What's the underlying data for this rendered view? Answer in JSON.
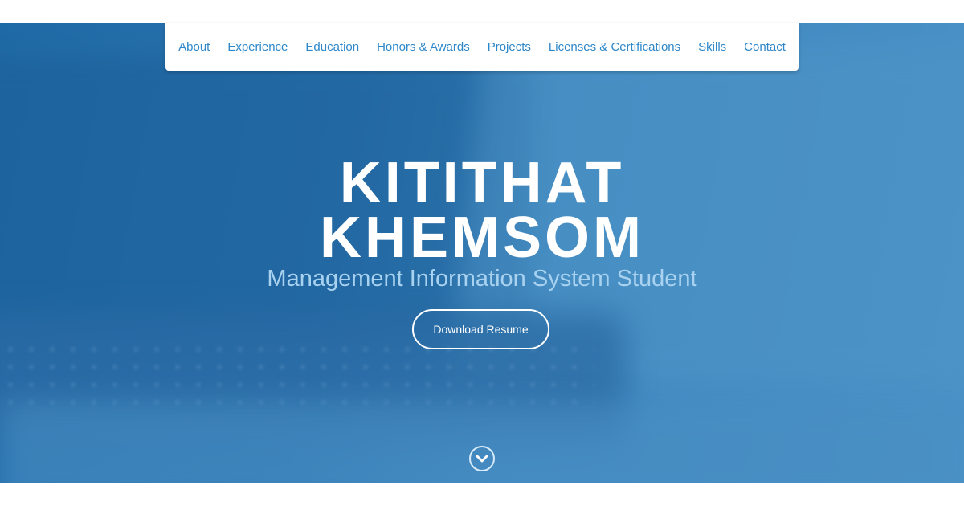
{
  "nav": {
    "items": [
      {
        "label": "About"
      },
      {
        "label": "Experience"
      },
      {
        "label": "Education"
      },
      {
        "label": "Honors & Awards"
      },
      {
        "label": "Projects"
      },
      {
        "label": "Licenses & Certifications"
      },
      {
        "label": "Skills"
      },
      {
        "label": "Contact"
      }
    ]
  },
  "hero": {
    "name_line1": "KITITHAT",
    "name_line2": "KHEMSOM",
    "subtitle": "Management Information System Student",
    "download_label": "Download Resume",
    "scroll_icon": "chevron-down-circle-icon"
  },
  "colors": {
    "nav_link": "#2d87c9",
    "hero_bg": "#2b74b0",
    "subtitle": "#a8d2f0"
  }
}
